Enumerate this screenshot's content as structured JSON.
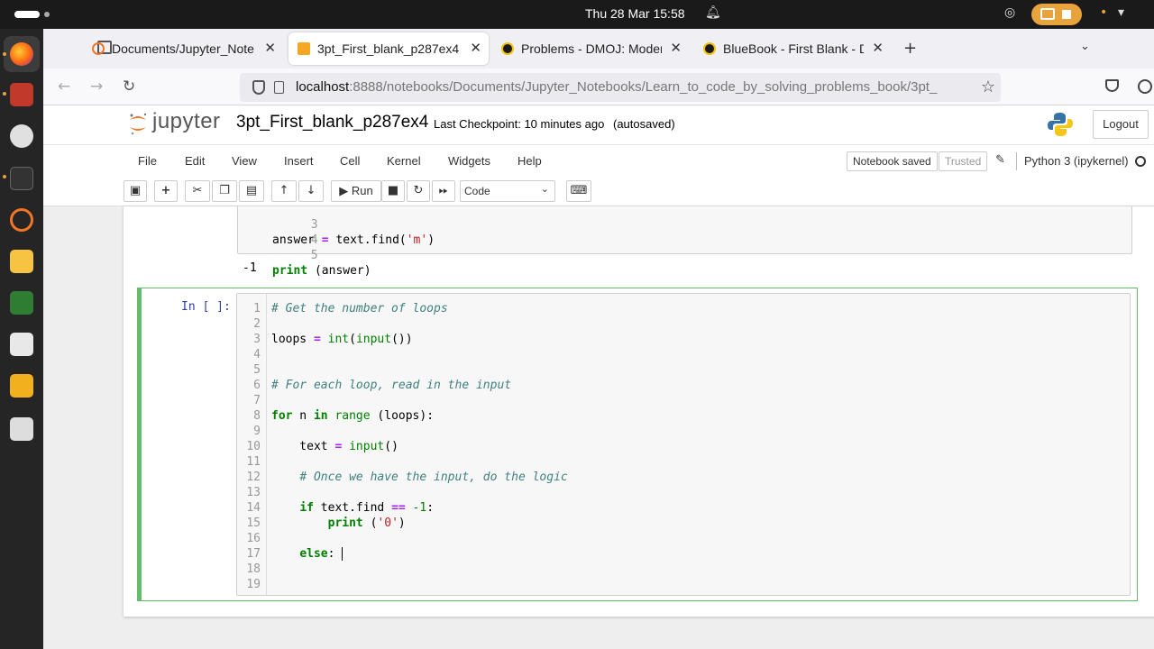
{
  "system": {
    "datetime": "Thu 28 Mar  15:58"
  },
  "browser": {
    "tabs": [
      {
        "label": "Documents/Jupyter_Note",
        "active": false,
        "icon": "jupyter-favicon"
      },
      {
        "label": "3pt_First_blank_p287ex4",
        "active": true,
        "icon": "notebook-favicon"
      },
      {
        "label": "Problems - DMOJ: Moder",
        "active": false,
        "icon": "dmoj-favicon"
      },
      {
        "label": "BlueBook - First Blank - D",
        "active": false,
        "icon": "dmoj-favicon"
      }
    ],
    "url_host": "localhost",
    "url_path": ":8888/notebooks/Documents/Jupyter_Notebooks/Learn_to_code_by_solving_problems_book/3pt_"
  },
  "jupyter": {
    "logo_text": "jupyter",
    "notebook_name": "3pt_First_blank_p287ex4",
    "checkpoint": "Last Checkpoint: 10 minutes ago",
    "autosave": "(autosaved)",
    "logout_label": "Logout",
    "menu": [
      "File",
      "Edit",
      "View",
      "Insert",
      "Cell",
      "Kernel",
      "Widgets",
      "Help"
    ],
    "notebook_saved": "Notebook saved",
    "trusted": "Trusted",
    "kernel_name": "Python 3 (ipykernel)",
    "run_label": "Run",
    "cell_type": "Code"
  },
  "previous_cell": {
    "lines": [
      {
        "n": "3",
        "code": "answer = text.find('m')"
      },
      {
        "n": "4",
        "code": ""
      },
      {
        "n": "5",
        "code": "print (answer)"
      }
    ],
    "output": "-1"
  },
  "current_cell": {
    "prompt": "In [ ]:",
    "lines": [
      {
        "n": "1",
        "code": "# Get the number of loops"
      },
      {
        "n": "2",
        "code": ""
      },
      {
        "n": "3",
        "code": "loops = int(input())"
      },
      {
        "n": "4",
        "code": ""
      },
      {
        "n": "5",
        "code": ""
      },
      {
        "n": "6",
        "code": "# For each loop, read in the input"
      },
      {
        "n": "7",
        "code": ""
      },
      {
        "n": "8",
        "code": "for n in range (loops):"
      },
      {
        "n": "9",
        "code": ""
      },
      {
        "n": "10",
        "code": "    text = input()"
      },
      {
        "n": "11",
        "code": ""
      },
      {
        "n": "12",
        "code": "    # Once we have the input, do the logic"
      },
      {
        "n": "13",
        "code": ""
      },
      {
        "n": "14",
        "code": "    if text.find == -1:"
      },
      {
        "n": "15",
        "code": "        print ('0')"
      },
      {
        "n": "16",
        "code": ""
      },
      {
        "n": "17",
        "code": "    else: "
      },
      {
        "n": "18",
        "code": ""
      },
      {
        "n": "19",
        "code": ""
      }
    ]
  },
  "colors": {
    "accent_orange": "#e8a33c",
    "cell_border_green": "#66bb6a",
    "prompt_blue": "#303f9f"
  }
}
